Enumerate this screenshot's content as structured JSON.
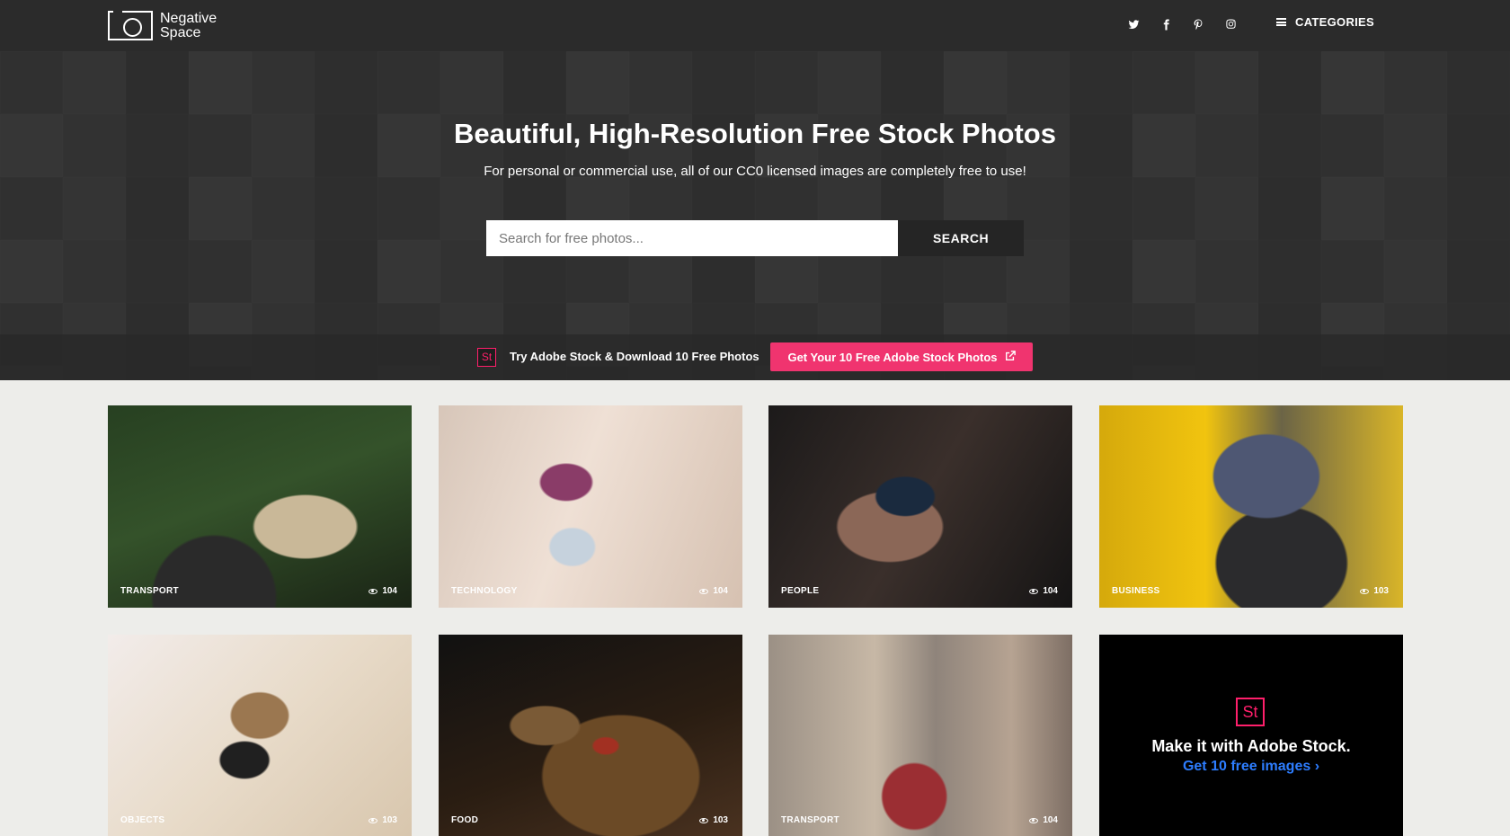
{
  "brand": {
    "name_line1": "Negative",
    "name_line2": "Space"
  },
  "nav": {
    "social": [
      "twitter-icon",
      "facebook-icon",
      "pinterest-icon",
      "instagram-icon"
    ],
    "categories_label": "CATEGORIES"
  },
  "hero": {
    "title": "Beautiful, High-Resolution Free Stock Photos",
    "subtitle": "For personal or commercial use, all of our CC0 licensed images are completely free to use!",
    "search_placeholder": "Search for free photos...",
    "search_button": "SEARCH"
  },
  "promo": {
    "badge": "St",
    "text": "Try Adobe Stock & Download 10 Free Photos",
    "button": "Get Your 10 Free Adobe Stock Photos"
  },
  "photos": [
    {
      "category": "TRANSPORT",
      "views": "104"
    },
    {
      "category": "TECHNOLOGY",
      "views": "104"
    },
    {
      "category": "PEOPLE",
      "views": "104"
    },
    {
      "category": "BUSINESS",
      "views": "103"
    },
    {
      "category": "OBJECTS",
      "views": "103"
    },
    {
      "category": "FOOD",
      "views": "103"
    },
    {
      "category": "TRANSPORT",
      "views": "104"
    }
  ],
  "ad_card": {
    "badge": "St",
    "title": "Make it with Adobe Stock.",
    "link": "Get 10 free images ›"
  },
  "colors": {
    "accent": "#f0346f",
    "link": "#2d7dff",
    "header": "#2b2b2b"
  }
}
